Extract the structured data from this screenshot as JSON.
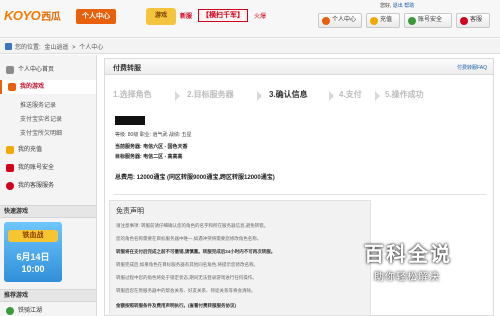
{
  "header": {
    "logo_text": "KOYO",
    "logo_cn": "西瓜",
    "user_center_label": "个人中心",
    "banner": {
      "game": "游戏",
      "tag": "新服",
      "hot": "【横扫千军】",
      "suffix": "火爆"
    },
    "greeting_prefix": "您好,",
    "greeting_links": [
      "退出",
      "帮助"
    ],
    "buttons": [
      {
        "label": "个人中心",
        "icon": "user-icon",
        "color": "#e8600c"
      },
      {
        "label": "充值",
        "icon": "coin-icon",
        "color": "#f2a900"
      },
      {
        "label": "账号安全",
        "icon": "lock-icon",
        "color": "#3a9a3a"
      },
      {
        "label": "客服",
        "icon": "service-icon",
        "color": "#d0021b"
      }
    ]
  },
  "breadcrumb": [
    "您的位置:",
    "金山逍遥",
    ">",
    "个人中心"
  ],
  "sidebar": {
    "items": [
      {
        "label": "个人中心首页",
        "icon": "home-icon",
        "color": "#8c8c8c"
      },
      {
        "label": "我的游戏",
        "icon": "gamepad-icon",
        "color": "#e8600c",
        "active": true
      },
      {
        "label": "推送服务记录",
        "icon": "",
        "color": "",
        "sub": true
      },
      {
        "label": "支付宝实名记录",
        "icon": "",
        "color": "",
        "sub": true
      },
      {
        "label": "支付宝所欠明细",
        "icon": "",
        "color": "",
        "sub": true
      },
      {
        "label": "我的充值",
        "icon": "coin-icon",
        "color": "#f2a900"
      },
      {
        "label": "我的账号安全",
        "icon": "lock-icon",
        "color": "#d0021b"
      },
      {
        "label": "我的客服服务",
        "icon": "service-icon",
        "color": "#d0021b"
      }
    ],
    "quick_games_title": "快速游戏",
    "promo": {
      "title": "铁血战",
      "days": "6月14日",
      "time": "10:00"
    },
    "recommend_title": "推荐游戏",
    "recommend_item": "铁骑江湖"
  },
  "main": {
    "title": "付费转服",
    "faq": "付费转服FAQ",
    "steps": [
      "1.选择角色",
      "2.目标服务器",
      "3.确认信息",
      "4.支付",
      "5.操作成功"
    ],
    "active_step": 2,
    "info": {
      "row1": "等级: 80级    职业: 逍气武    战绩: 五星",
      "current_server_label": "当前服务器:",
      "current_server": "电信六区 - 国色天香",
      "target_server_label": "目标服务器:",
      "target_server": "电信二区 - 高高高",
      "total": "总费用: 12000通宝 (同区转服9000通宝,跨区转服12000通宝)"
    },
    "disclaimer": {
      "title": "免责声明",
      "lines": [
        "请注意事项: 转服前请仔细确认您的角色的名字和所在服务器信息,避免转错。",
        "您的角色名称需要在目标服务器中唯一,如遇冲突将需要您修改角色名称。",
        "转服将在支付后完成之前不可撤销,请慎重。转服完成后24小时内不可再次转服。",
        "转服完成后,如果角色在目标服务器有其他同名角色,将提示您修改名称。",
        "转服过程中您的角色将处于锁定状态,期间无法登录游戏进行任何操作。",
        "转服后您在原服务器中的帮会关系、好友关系、师徒关系等将会清除。",
        "金额按照转服条件及费用声明执行。(查看付费转服服务协议)"
      ],
      "link": "(查看付费转服服务协议)"
    }
  },
  "watermark": {
    "title": "百科全说",
    "subtitle": "助你轻松解决"
  }
}
